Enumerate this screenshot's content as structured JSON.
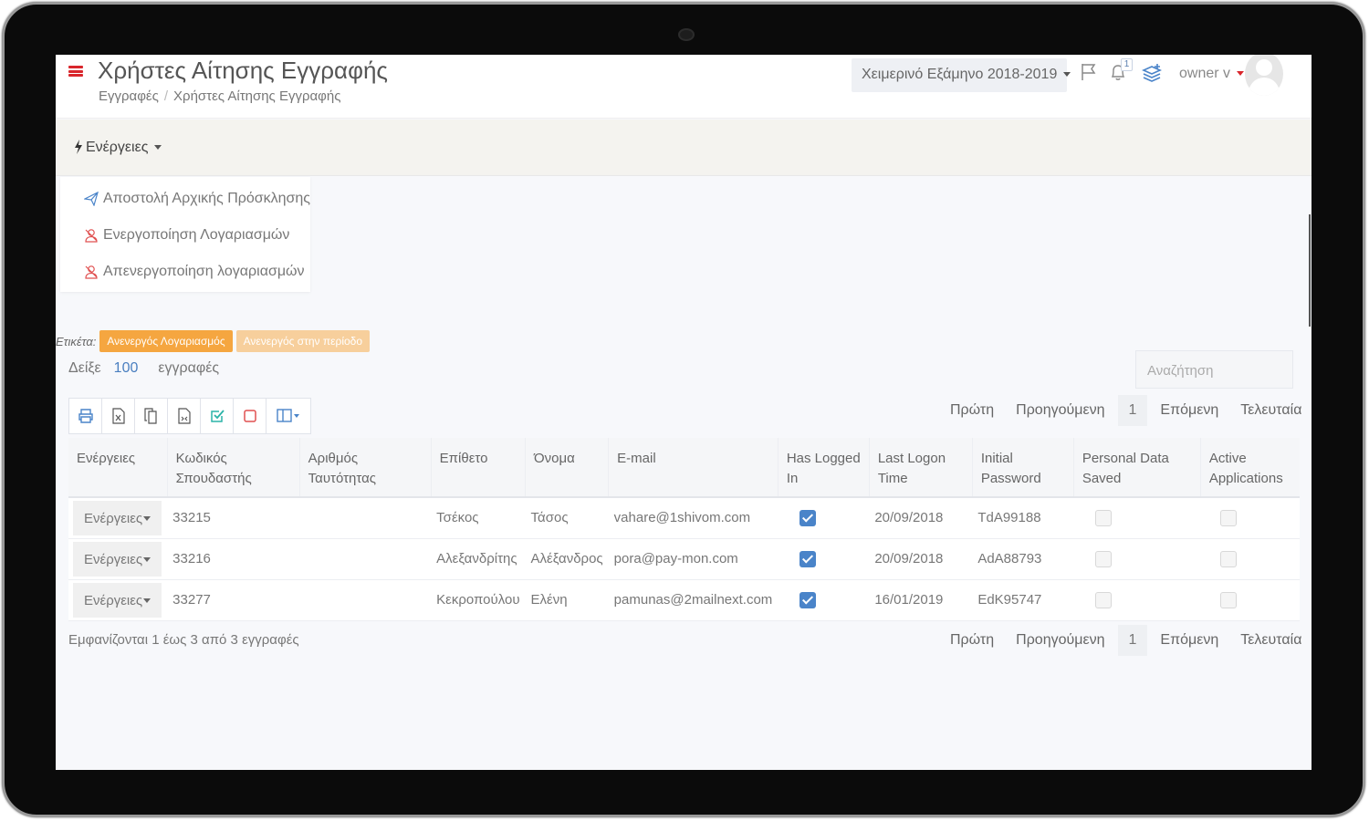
{
  "header": {
    "title": "Χρήστες Αίτησης Εγγραφής",
    "breadcrumb": [
      "Εγγραφές",
      "Χρήστες Αίτησης Εγγραφής"
    ],
    "semester": "Χειμερινό Εξάμηνο 2018-2019",
    "notification_count": "1",
    "user": "owner v"
  },
  "actions": {
    "toggle_label": "Ενέργειες",
    "menu": [
      {
        "label": "Αποστολή Αρχικής Πρόσκλησης",
        "icon": "send-icon"
      },
      {
        "label": "Ενεργοποίηση Λογαριασμών",
        "icon": "user-icon"
      },
      {
        "label": "Απενεργοποίηση λογαριασμών",
        "icon": "user-icon"
      }
    ]
  },
  "tags": {
    "label": "Ετικέτα:",
    "items": [
      "Ανενεργός Λογαριασμός",
      "Ανενεργός στην περίοδο"
    ]
  },
  "length": {
    "prefix": "Δείξε",
    "value": "100",
    "suffix": "εγγραφές"
  },
  "search": {
    "placeholder": "Αναζήτηση"
  },
  "toolbar": {
    "buttons": [
      "print-icon",
      "excel-icon",
      "copy-icon",
      "csv-icon",
      "select-all-icon",
      "deselect-icon",
      "columns-icon"
    ]
  },
  "pagination": {
    "first": "Πρώτη",
    "prev": "Προηγούμενη",
    "current": "1",
    "next": "Επόμενη",
    "last": "Τελευταία"
  },
  "table": {
    "columns": [
      [
        "Ενέργειες"
      ],
      [
        "Κωδικός",
        "Σπουδαστής"
      ],
      [
        "Αριθμός",
        "Ταυτότητας"
      ],
      [
        "Επίθετο"
      ],
      [
        "Όνομα"
      ],
      [
        "E-mail"
      ],
      [
        "Has Logged",
        "In"
      ],
      [
        "Last Logon",
        "Time"
      ],
      [
        "Initial",
        "Password"
      ],
      [
        "Personal Data",
        "Saved"
      ],
      [
        "Active",
        "Applications"
      ]
    ],
    "row_action_label": "Ενέργειες",
    "rows": [
      {
        "code": "33215",
        "id_number": "",
        "surname": "Τσέκος",
        "name": "Τάσος",
        "email": "vahare@1shivom.com",
        "logged_in": true,
        "last_logon": "20/09/2018",
        "initial_password": "TdA99188",
        "personal_data_saved": false,
        "active_applications": false
      },
      {
        "code": "33216",
        "id_number": "",
        "surname": "Αλεξανδρίτης",
        "name": "Αλέξανδρος",
        "email": "pora@pay-mon.com",
        "logged_in": true,
        "last_logon": "20/09/2018",
        "initial_password": "AdA88793",
        "personal_data_saved": false,
        "active_applications": false
      },
      {
        "code": "33277",
        "id_number": "",
        "surname": "Κεκροπούλου",
        "name": "Ελένη",
        "email": "pamunas@2mailnext.com",
        "logged_in": true,
        "last_logon": "16/01/2019",
        "initial_password": "EdK95747",
        "personal_data_saved": false,
        "active_applications": false
      }
    ]
  },
  "info": "Εμφανίζονται 1 έως 3 από 3 εγγραφές",
  "colors": {
    "accent_red": "#d9262c",
    "link_blue": "#4a7fc0",
    "check_blue": "#4a84c9",
    "tag_orange": "#f5a640",
    "tag_orange_light": "#f7cf9c"
  }
}
